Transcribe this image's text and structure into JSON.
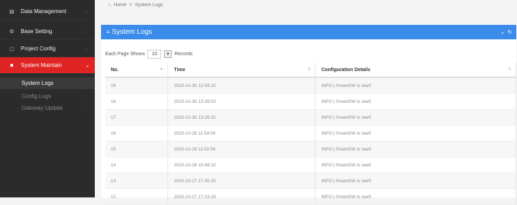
{
  "sidebar": {
    "items": [
      {
        "label": "Data Management",
        "icon": "database-icon"
      },
      {
        "label": "Base Setting",
        "icon": "gears-icon"
      },
      {
        "label": "Project Config",
        "icon": "file-icon"
      },
      {
        "label": "System Maintain",
        "icon": "tools-icon"
      }
    ],
    "sub_items": [
      {
        "label": "System Logs"
      },
      {
        "label": "Config Logs"
      },
      {
        "label": "Gateway Update"
      }
    ]
  },
  "breadcrumb": {
    "home": "Home",
    "separator": ">",
    "current": "System Logs"
  },
  "panel": {
    "title": "System Logs",
    "tools": [
      "⌄",
      "↻"
    ]
  },
  "perpage": {
    "prefix": "Each Page Shows",
    "value": "10",
    "suffix": "Records"
  },
  "table": {
    "columns": [
      "No.",
      "Time",
      "Configuration Details"
    ],
    "rows": [
      {
        "no": "19",
        "time": "2015-10-30 15:59:15",
        "details": "INFO | SmartGW is start!"
      },
      {
        "no": "18",
        "time": "2015-10-30 13:39:03",
        "details": "INFO | SmartGW is start!"
      },
      {
        "no": "17",
        "time": "2015-10-30 13:26:22",
        "details": "INFO | SmartGW is start!"
      },
      {
        "no": "16",
        "time": "2015-10-28 11:54:59",
        "details": "INFO | SmartGW is start!"
      },
      {
        "no": "15",
        "time": "2015-10-28 11:02:56",
        "details": "INFO | SmartGW is start!"
      },
      {
        "no": "14",
        "time": "2015-10-28 10:46:12",
        "details": "INFO | SmartGW is start!"
      },
      {
        "no": "13",
        "time": "2015-10-27 17:35:15",
        "details": "INFO | SmartGW is start!"
      },
      {
        "no": "12",
        "time": "2015-10-27 17:23:16",
        "details": "INFO | SmartGW is start!"
      }
    ]
  },
  "colors": {
    "accent": "#3b8beb",
    "active": "#e02424",
    "sidebar": "#2b2b2b"
  }
}
